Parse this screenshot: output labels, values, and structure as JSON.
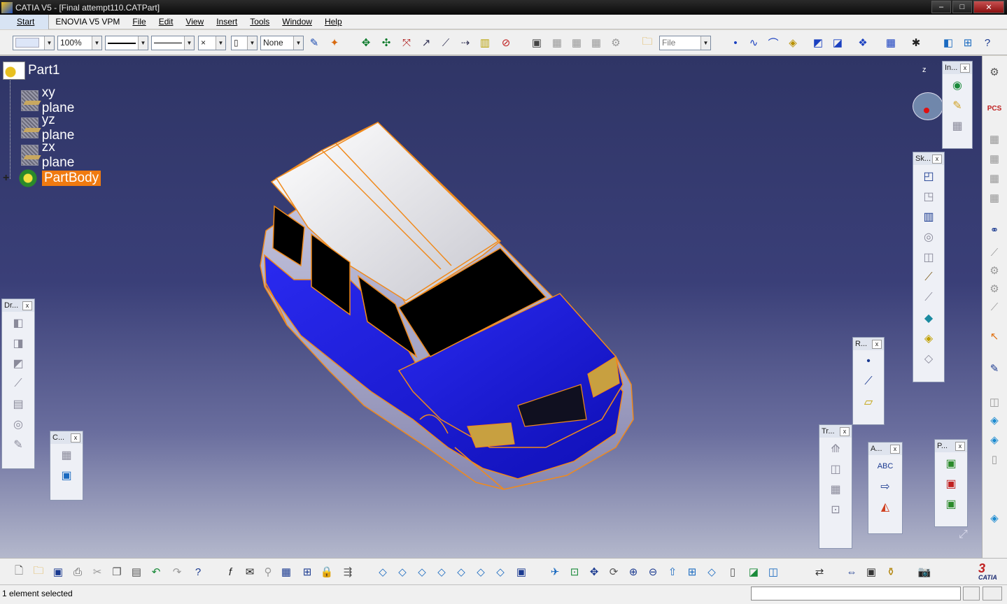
{
  "window": {
    "title": "CATIA V5 - [Final attempt110.CATPart]",
    "min": "–",
    "max": "□",
    "close": "✕"
  },
  "menu": {
    "start": "Start",
    "enovia": "ENOVIA V5 VPM",
    "file": "File",
    "edit": "Edit",
    "view": "View",
    "insert": "Insert",
    "tools": "Tools",
    "window": "Window",
    "help": "Help"
  },
  "toolbar": {
    "zoom": "100%",
    "layer": "None",
    "file_combo": "File"
  },
  "tree": {
    "root": "Part1",
    "planes": [
      "xy plane",
      "yz plane",
      "zx plane"
    ],
    "body": "PartBody",
    "expand": "+"
  },
  "panels": {
    "info": "In...",
    "sketcher": "Sk...",
    "drafting": "Dr...",
    "constraints": "C...",
    "reference": "R...",
    "transform": "Tr...",
    "annotations": "A...",
    "product": "P...",
    "close": "x"
  },
  "status": {
    "message": "1 element selected"
  },
  "compass": {
    "axis": "z"
  },
  "brand": {
    "name": "CATIA"
  },
  "colors": {
    "body_blue": "#1e1ed8",
    "edge_orange": "#f08a1c",
    "roof_white": "#f4f4f4",
    "selection": "#f07a10"
  }
}
